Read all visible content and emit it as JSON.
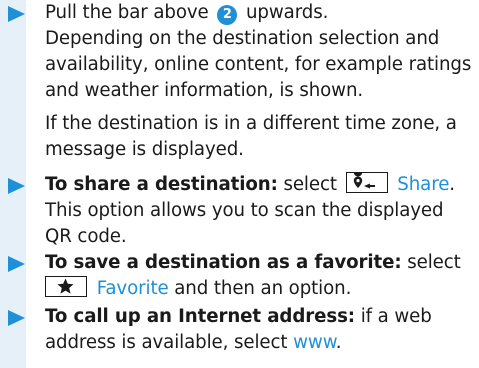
{
  "step1": {
    "line1_before": "Pull the bar above",
    "badge": "2",
    "line1_after": "upwards.",
    "line2": "Depending on the destination selection and",
    "line3": "availability, online content, for example ratings",
    "line4": "and weather information, is shown."
  },
  "note": {
    "line1": "If the destination is in a different time zone, a",
    "line2": "message is displayed."
  },
  "step2": {
    "bold": "To share a destination:",
    "select": "select",
    "action": "Share",
    "icon": "share-location-icon",
    "after": ".",
    "line2": "This option allows you to scan the displayed",
    "line3": "QR code."
  },
  "step3": {
    "bold": "To save a destination as a favorite:",
    "select": "select",
    "icon": "star-icon",
    "action": "Favorite",
    "after": "and then an option."
  },
  "step4": {
    "bold": "To call up an Internet address:",
    "text": "if a web",
    "line2_before": "address is available, select",
    "link": "www",
    "line2_after": "."
  },
  "colors": {
    "accent": "#1f8fd8",
    "sidebar": "#e6f0f9",
    "text": "#1a1a1a"
  }
}
